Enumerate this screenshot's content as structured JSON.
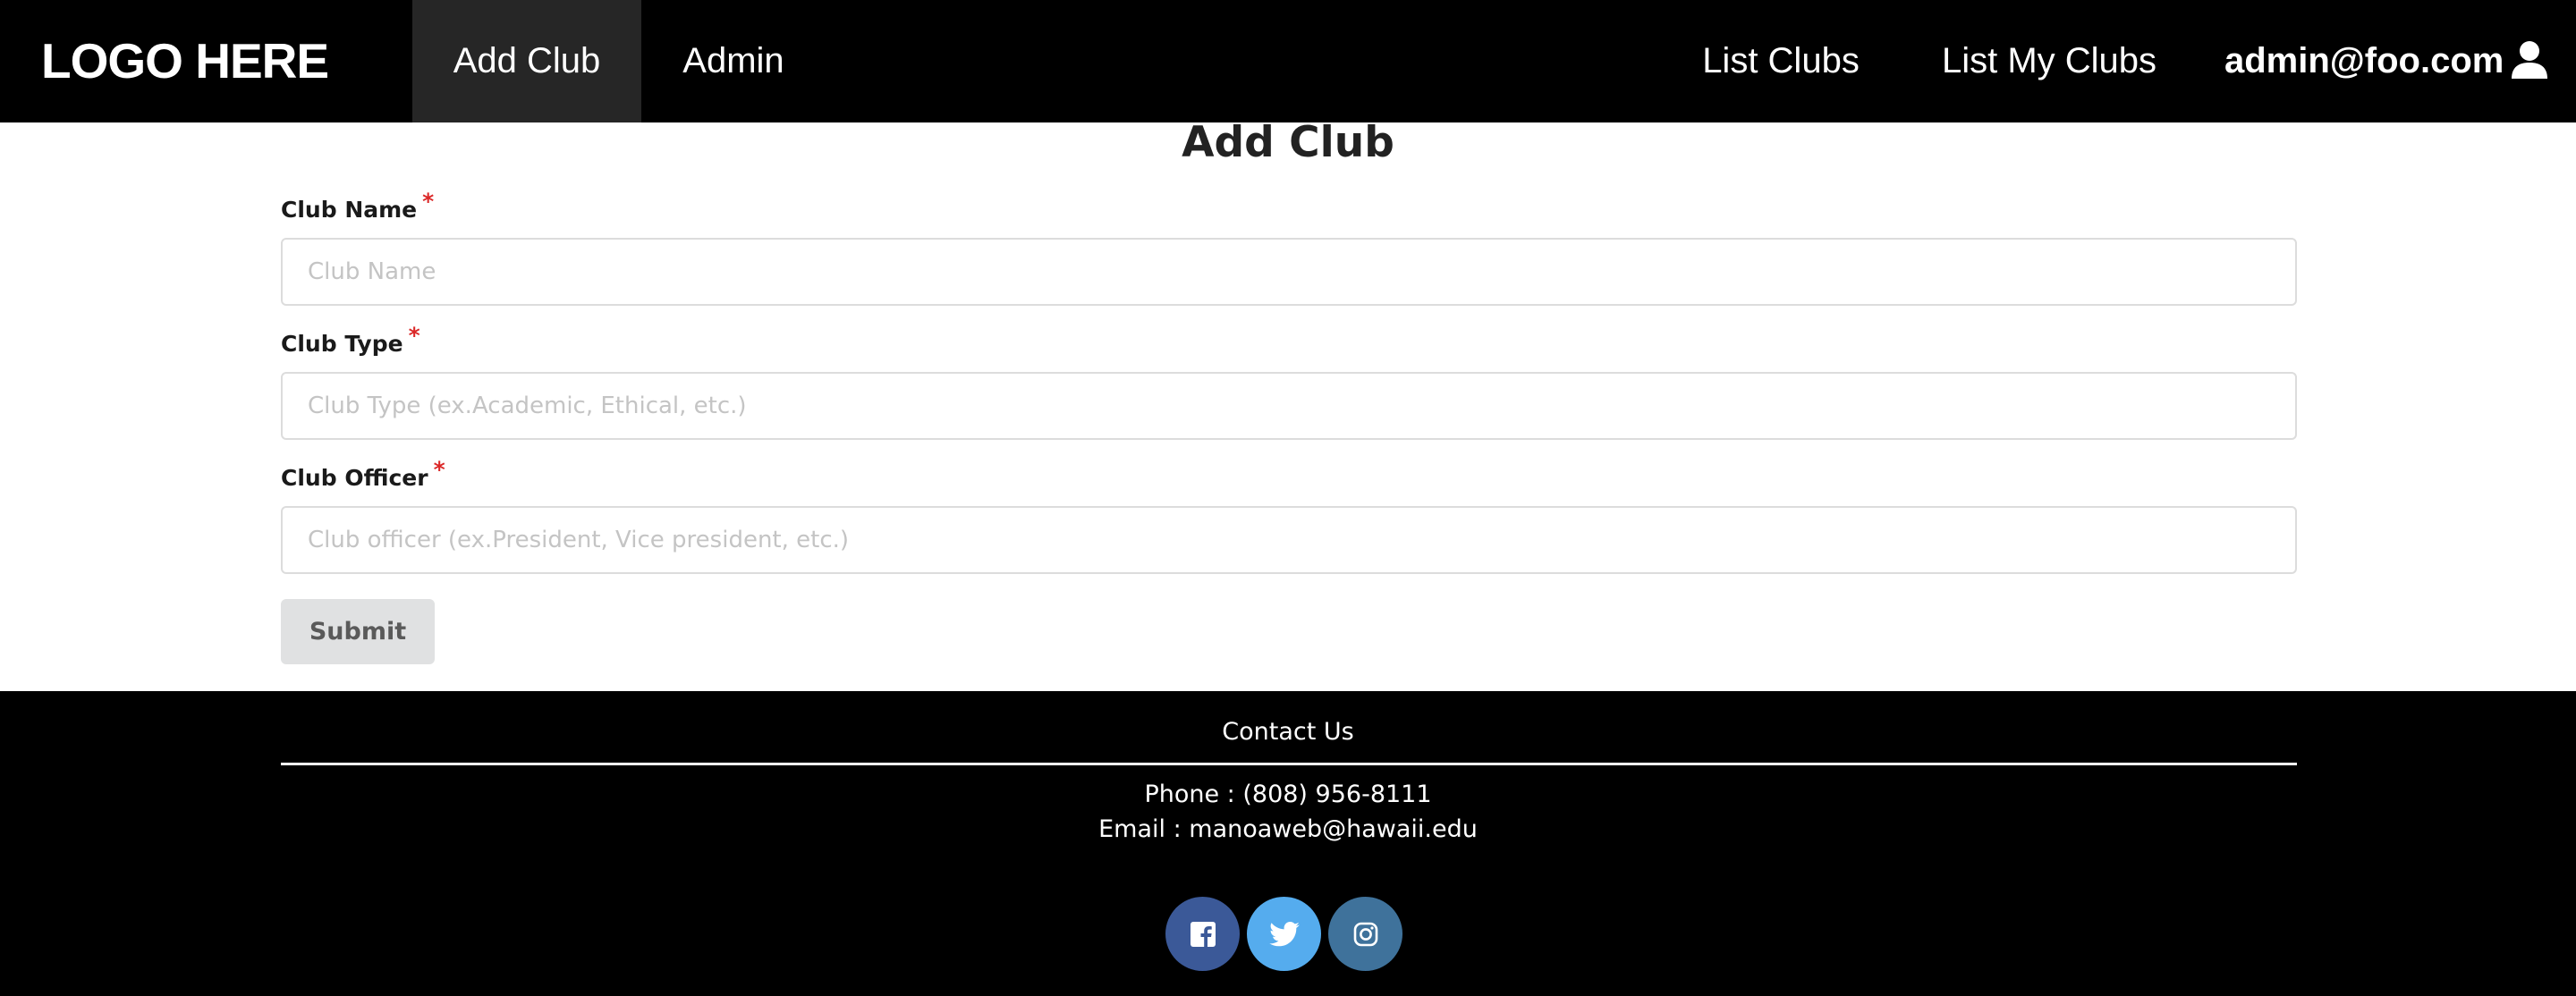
{
  "navbar": {
    "logo": "LOGO HERE",
    "items": [
      {
        "label": "Add Club",
        "active": true
      },
      {
        "label": "Admin"
      },
      {
        "label": "List Clubs"
      },
      {
        "label": "List My Clubs"
      }
    ],
    "user": {
      "label": "admin@foo.com",
      "icon": "user-icon"
    }
  },
  "form": {
    "title": "Add Club",
    "fields": [
      {
        "label": "Club Name",
        "required_mark": "*",
        "placeholder": "Club Name",
        "value": ""
      },
      {
        "label": "Club Type",
        "required_mark": "*",
        "placeholder": "Club Type (ex.Academic, Ethical, etc.)",
        "value": ""
      },
      {
        "label": "Club Officer",
        "required_mark": "*",
        "placeholder": "Club officer (ex.President, Vice president, etc.)",
        "value": ""
      }
    ],
    "submit_label": "Submit"
  },
  "footer": {
    "title": "Contact Us",
    "phone": "Phone : (808) 956-8111",
    "email": "Email : manoaweb@hawaii.edu",
    "social": [
      {
        "icon": "facebook-icon",
        "color": "#3b5998"
      },
      {
        "icon": "twitter-icon",
        "color": "#55acee"
      },
      {
        "icon": "instagram-icon",
        "color": "#3f729b"
      }
    ]
  },
  "colors": {
    "navbar_bg": "#000000",
    "active_nav_bg": "#262626",
    "required": "#db2828",
    "submit_bg": "#e0e1e2"
  }
}
